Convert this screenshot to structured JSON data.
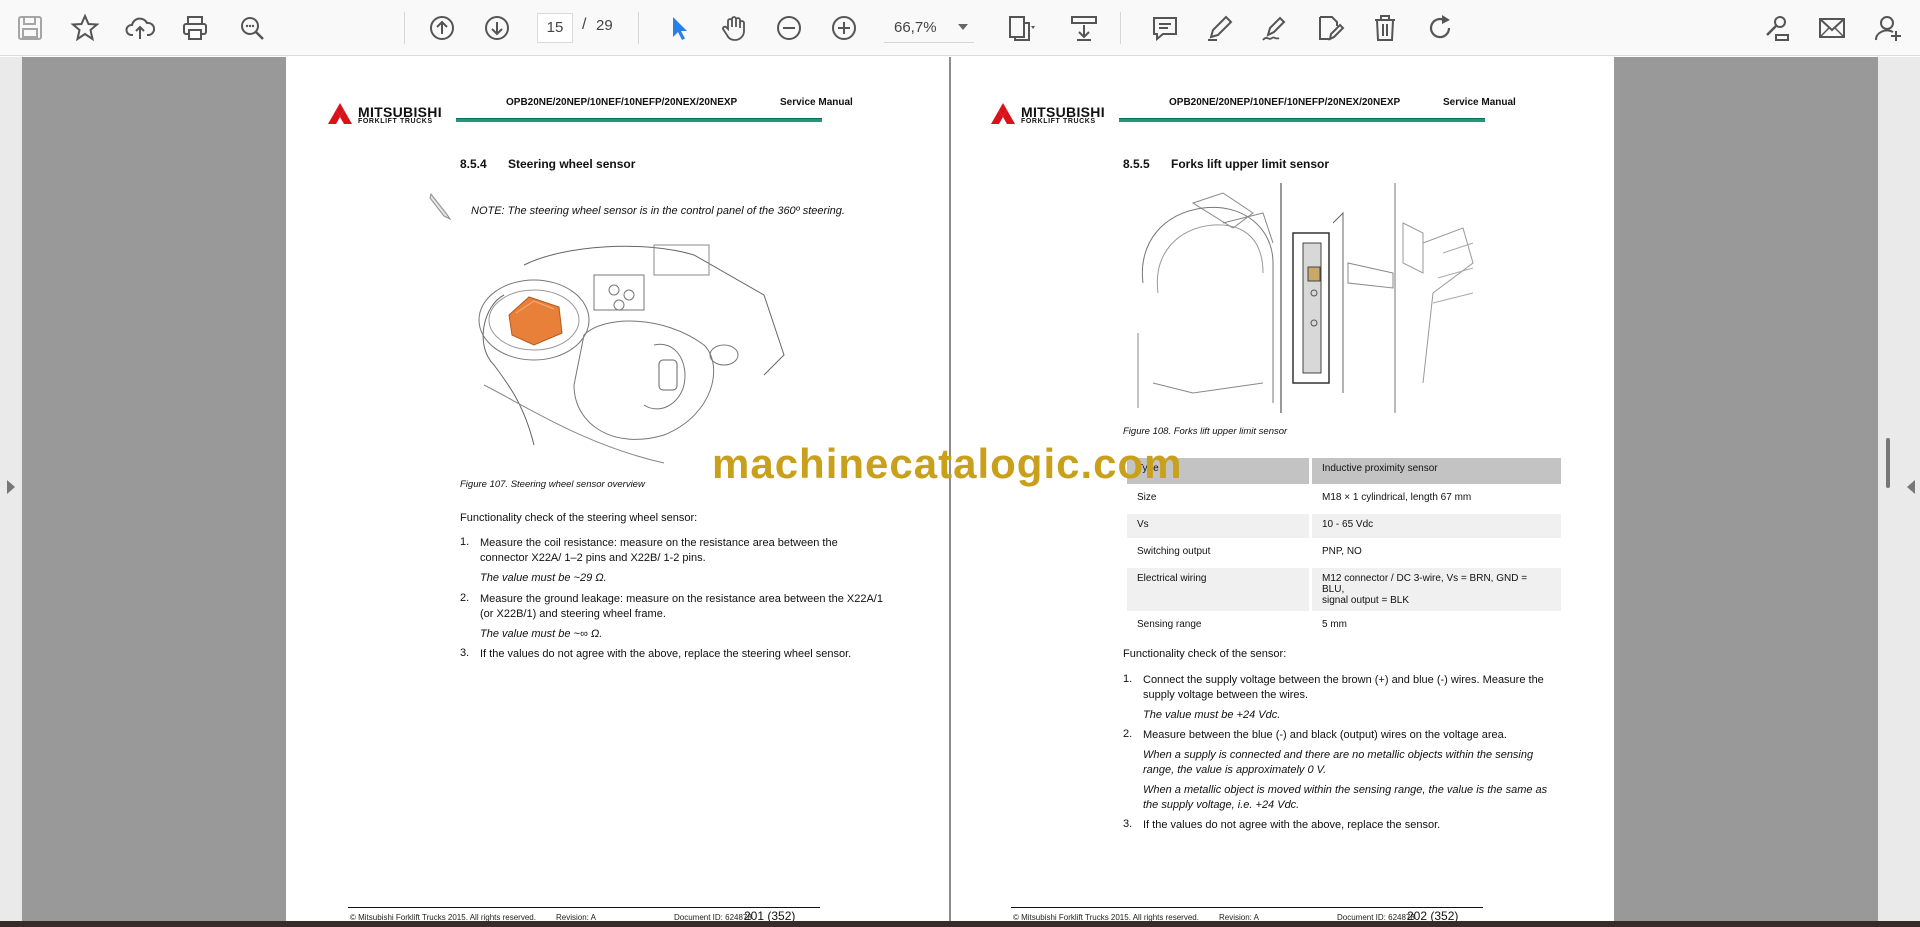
{
  "toolbar": {
    "page_current": "15",
    "page_sep": "/",
    "page_total": "29",
    "zoom": "66,7%",
    "icons": [
      "save-icon",
      "star-icon",
      "upload-icon",
      "print-icon",
      "zoom-search-icon",
      "arrow-up-icon",
      "arrow-down-icon",
      "select-cursor-icon",
      "hand-icon",
      "zoom-out-icon",
      "zoom-in-icon",
      "page-fit-icon",
      "scroll-mode-icon",
      "comment-icon",
      "pen-icon",
      "sign-icon",
      "edit-icon",
      "delete-icon",
      "rotate-icon",
      "tools-link-icon",
      "mail-icon",
      "add-user-icon"
    ]
  },
  "watermark": "machinecatalogic.com",
  "left_page": {
    "brand": "MITSUBISHI",
    "brand_sub": "FORKLIFT TRUCKS",
    "model": "OPB20NE/20NEP/10NEF/10NEFP/20NEX/20NEXP",
    "kind": "Service Manual",
    "section_num": "8.5.4",
    "section_title": "Steering wheel sensor",
    "note": "NOTE: The steering wheel sensor is in the control panel of the 360º steering.",
    "figure_caption": "Figure 107. Steering wheel sensor overview",
    "check_intro": "Functionality check of the steering wheel sensor:",
    "items": [
      {
        "num": "1.",
        "line1": "Measure the coil resistance: measure on the resistance area between the",
        "line2": "connector X22A/ 1–2 pins and X22B/ 1-2 pins.",
        "result": "The value must be ~29 Ω."
      },
      {
        "num": "2.",
        "line1": "Measure the ground leakage: measure on the resistance area between the X22A/1",
        "line2": "(or X22B/1) and steering wheel frame.",
        "result": "The value must be ~∞ Ω."
      },
      {
        "num": "3.",
        "line1": "If the values do not agree with the above, replace the steering wheel sensor."
      }
    ],
    "footer_copyright": "© Mitsubishi Forklift Trucks 2015. All rights reserved.",
    "footer_revision": "Revision: A",
    "footer_docid": "Document ID: 624878",
    "footer_page": "201 (352)"
  },
  "right_page": {
    "brand": "MITSUBISHI",
    "brand_sub": "FORKLIFT TRUCKS",
    "model": "OPB20NE/20NEP/10NEF/10NEFP/20NEX/20NEXP",
    "kind": "Service Manual",
    "section_num": "8.5.5",
    "section_title": "Forks lift upper limit sensor",
    "figure_caption": "Figure 108. Forks lift upper limit sensor",
    "table": [
      {
        "key": "Type",
        "value": "Inductive proximity sensor"
      },
      {
        "key": "Size",
        "value": "M18 × 1 cylindrical, length 67 mm"
      },
      {
        "key": "Vs",
        "value": "10 - 65 Vdc"
      },
      {
        "key": "Switching output",
        "value": "PNP, NO"
      },
      {
        "key": "Electrical wiring",
        "value": "M12 connector / DC 3-wire, Vs = BRN, GND = BLU,",
        "value2": "signal output = BLK"
      },
      {
        "key": "Sensing range",
        "value": "5 mm"
      }
    ],
    "check_intro": "Functionality check of the sensor:",
    "items": [
      {
        "num": "1.",
        "line1": "Connect the supply voltage between the brown (+) and blue (-) wires. Measure the",
        "line2": "supply voltage between the wires.",
        "result": "The value must be +24 Vdc."
      },
      {
        "num": "2.",
        "line1": "Measure between the blue (-) and black (output) wires on the voltage area.",
        "result": "When a supply is connected and there are no metallic objects within the sensing",
        "result2": "range, the value is approximately 0 V.",
        "result3": "When a metallic object is moved within the sensing range, the value is the same as",
        "result4": "the supply voltage, i.e. +24 Vdc."
      },
      {
        "num": "3.",
        "line1": "If the values do not agree with the above, replace the sensor."
      }
    ],
    "footer_copyright": "© Mitsubishi Forklift Trucks 2015. All rights reserved.",
    "footer_revision": "Revision: A",
    "footer_docid": "Document ID: 624878",
    "footer_page": "202 (352)"
  }
}
